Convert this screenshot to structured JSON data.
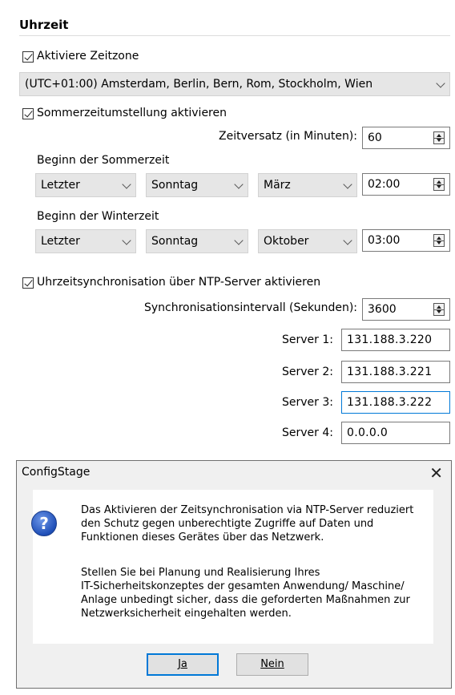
{
  "section": {
    "title": "Uhrzeit"
  },
  "timezone": {
    "checkbox_label": "Aktiviere Zeitzone",
    "checked": true,
    "selected": "(UTC+01:00) Amsterdam, Berlin, Bern, Rom, Stockholm, Wien"
  },
  "dst": {
    "checkbox_label": "Sommerzeitumstellung aktivieren",
    "checked": true,
    "offset_label": "Zeitversatz (in Minuten):",
    "offset_value": "60",
    "summer": {
      "label": "Beginn der Sommerzeit",
      "week": "Letzter",
      "day": "Sonntag",
      "month": "März",
      "time": "02:00"
    },
    "winter": {
      "label": "Beginn der Winterzeit",
      "week": "Letzter",
      "day": "Sonntag",
      "month": "Oktober",
      "time": "03:00"
    }
  },
  "ntp": {
    "checkbox_label": "Uhrzeitsynchronisation über NTP-Server aktivieren",
    "checked": true,
    "interval_label": "Synchronisationsintervall (Sekunden):",
    "interval_value": "3600",
    "servers": [
      {
        "label": "Server 1:",
        "value": "131.188.3.220"
      },
      {
        "label": "Server 2:",
        "value": "131.188.3.221"
      },
      {
        "label": "Server 3:",
        "value": "131.188.3.222"
      },
      {
        "label": "Server 4:",
        "value": "0.0.0.0"
      }
    ]
  },
  "dialog": {
    "title": "ConfigStage",
    "close_symbol": "✕",
    "icon": "question-icon",
    "icon_glyph": "?",
    "para1": [
      "Das Aktivieren der Zeitsynchronisation via NTP-Server reduziert",
      "den Schutz gegen unberechtigte Zugriffe auf Daten und",
      "Funktionen dieses Gerätes über das Netzwerk."
    ],
    "para2": [
      "Stellen Sie bei Planung und Realisierung Ihres",
      "IT-Sicherheitskonzeptes der gesamten Anwendung/ Maschine/",
      "Anlage unbedingt sicher, dass die geforderten Maßnahmen zur",
      "Netzwerksicherheit eingehalten werden."
    ],
    "yes_label": "Ja",
    "no_label": "Nein"
  }
}
